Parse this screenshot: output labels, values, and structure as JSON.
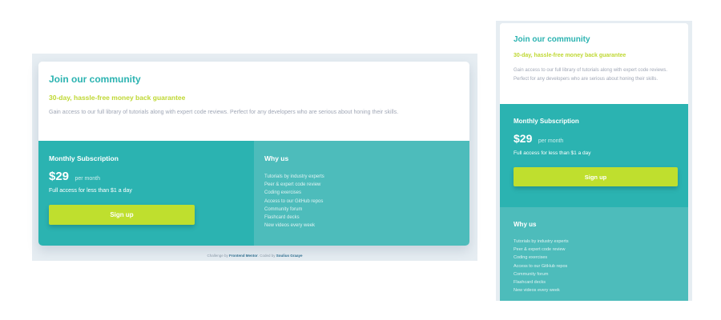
{
  "card": {
    "title": "Join our community",
    "tagline": "30-day, hassle-free money back guarantee",
    "description": "Gain access to our full library of tutorials along with expert code reviews. Perfect for any developers who are serious about honing their skills."
  },
  "subscription": {
    "heading": "Monthly Subscription",
    "price": "$29",
    "per": "per month",
    "note": "Full access for less than $1 a day",
    "button_label": "Sign up"
  },
  "why_us": {
    "heading": "Why us",
    "features": [
      "Tutorials by industry experts",
      "Peer & expert code review",
      "Coding exercises",
      "Access to our GitHub repos",
      "Community forum",
      "Flashcard decks",
      "New videos every week"
    ]
  },
  "attribution": {
    "prefix": "Challenge by",
    "challenge_link": "Frontend Mentor",
    "middle": ". Coded by",
    "author_link": "Soulius Graaye"
  },
  "colors": {
    "accent_teal": "#2bb3b1",
    "accent_teal_light": "#4dbcbb",
    "accent_lime": "#bfdf2e",
    "text_gray": "#a0a7b6"
  }
}
